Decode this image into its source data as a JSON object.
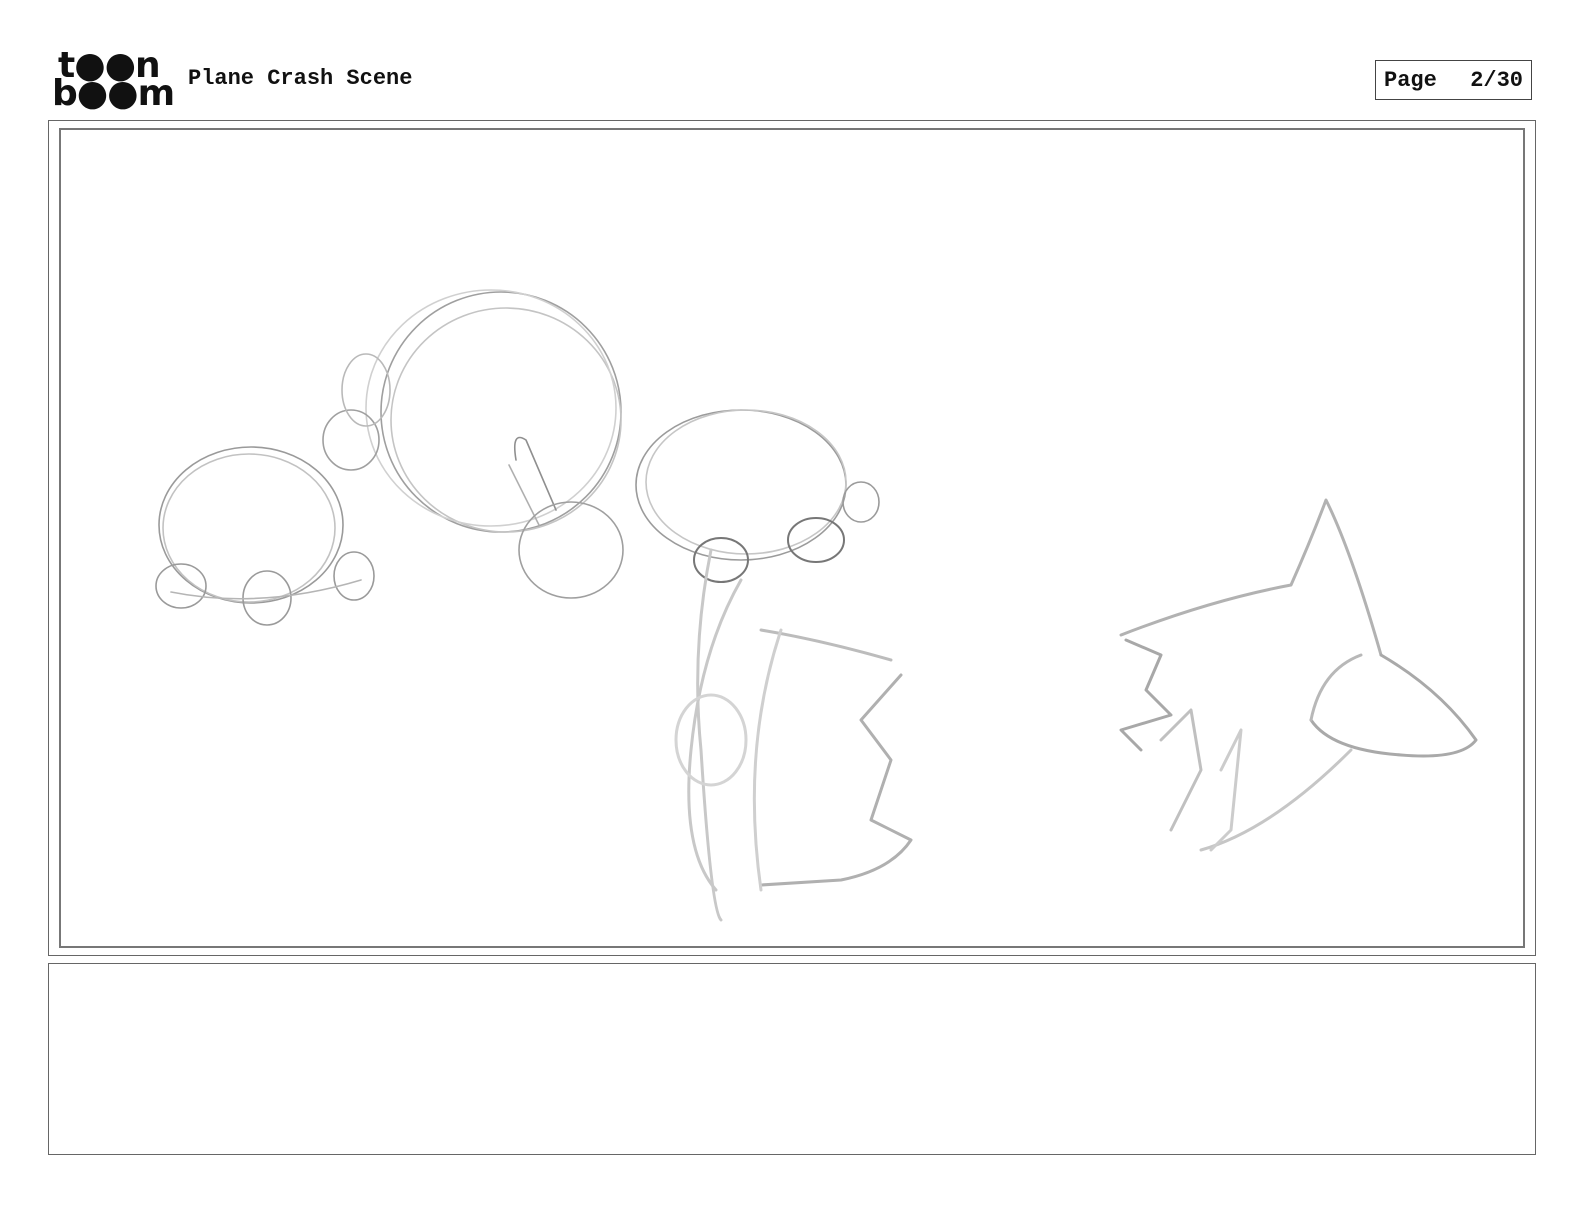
{
  "logo": {
    "line1": "t●●n",
    "line2": "b●●m"
  },
  "header": {
    "title": "Plane Crash Scene",
    "page_label": "Page",
    "page_number": "2/30"
  },
  "panel": {
    "caption": ""
  }
}
